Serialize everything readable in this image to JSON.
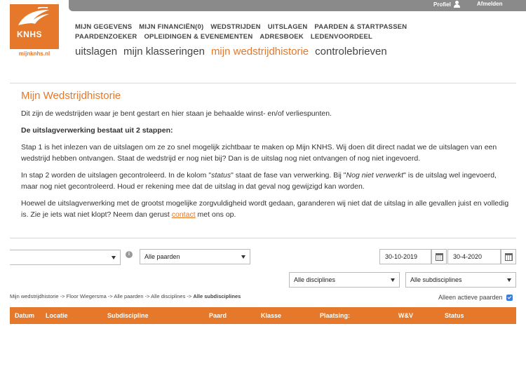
{
  "topbar": {
    "profile": "Profiel",
    "logout": "Afmelden"
  },
  "logo": {
    "brand": "KNHS",
    "site": "mijnknhs.nl"
  },
  "main_nav": [
    "MIJN GEGEVENS",
    "MIJN FINANCIËN(0)",
    "WEDSTRIJDEN",
    "UITSLAGEN",
    "PAARDEN & STARTPASSEN",
    "PAARDENZOEKER",
    "OPLEIDINGEN & EVENEMENTEN",
    "ADRESBOEK",
    "LEDENVOORDEEL"
  ],
  "sub_nav": {
    "items": [
      "uitslagen",
      "mijn klasseringen",
      "mijn wedstrijdhistorie",
      "controlebrieven"
    ],
    "active": "mijn wedstrijdhistorie"
  },
  "content": {
    "title": "Mijn Wedstrijdhistorie",
    "intro": "Dit zijn de wedstrijden waar je bent gestart en hier staan je behaalde winst- en/of verliespunten.",
    "steps_heading": "De uitslagverwerking bestaat uit 2 stappen:",
    "step1": "Stap 1 is het inlezen van de uitslagen om ze zo snel mogelijk zichtbaar te maken op Mijn KNHS. Wij doen dit direct nadat we de uitslagen van een wedstrijd hebben ontvangen. Staat de wedstrijd er nog niet bij? Dan is de uitslag nog niet ontvangen of nog niet ingevoerd.",
    "step2_a": "In stap 2 worden de uitslagen gecontroleerd. In de kolom \"",
    "step2_status": "status",
    "step2_b": "\" staat de fase van verwerking. Bij \"",
    "step2_nnv": "Nog niet verwerkt",
    "step2_c": "\" is de uitslag wel ingevoerd, maar nog niet gecontroleerd. Houd er rekening mee dat de uitslag in dat geval nog gewijzigd kan worden.",
    "disclaimer_a": "Hoewel de uitslagverwerking met de grootst mogelijke zorgvuldigheid wordt gedaan, garanderen wij niet dat de uitslag in alle gevallen juist en volledig is. Zie je iets wat niet klopt? Neem dan gerust ",
    "contact_link": "contact",
    "disclaimer_b": " met ons op."
  },
  "filters": {
    "rider": "",
    "horses": "Alle paarden",
    "date_from": "30-10-2019",
    "date_to": "30-4-2020",
    "disciplines": "Alle disciplines",
    "subdisciplines": "Alle subdisciplines",
    "active_horses_label": "Alleen actieve paarden"
  },
  "breadcrumb": {
    "path": "Mijn wedstrijdhistorie -> Floor Wiegersma -> Alle paarden -> Alle disciplines -> ",
    "last": "Alle subdisciplines"
  },
  "table": {
    "columns": [
      "Datum",
      "Locatie",
      "Subdiscipline",
      "Paard",
      "Klasse",
      "Plaatsing:",
      "W&V",
      "Status"
    ]
  },
  "colors": {
    "accent": "#e5782a",
    "topbar": "#8a8a8a",
    "checkbox": "#3b7ddd"
  }
}
